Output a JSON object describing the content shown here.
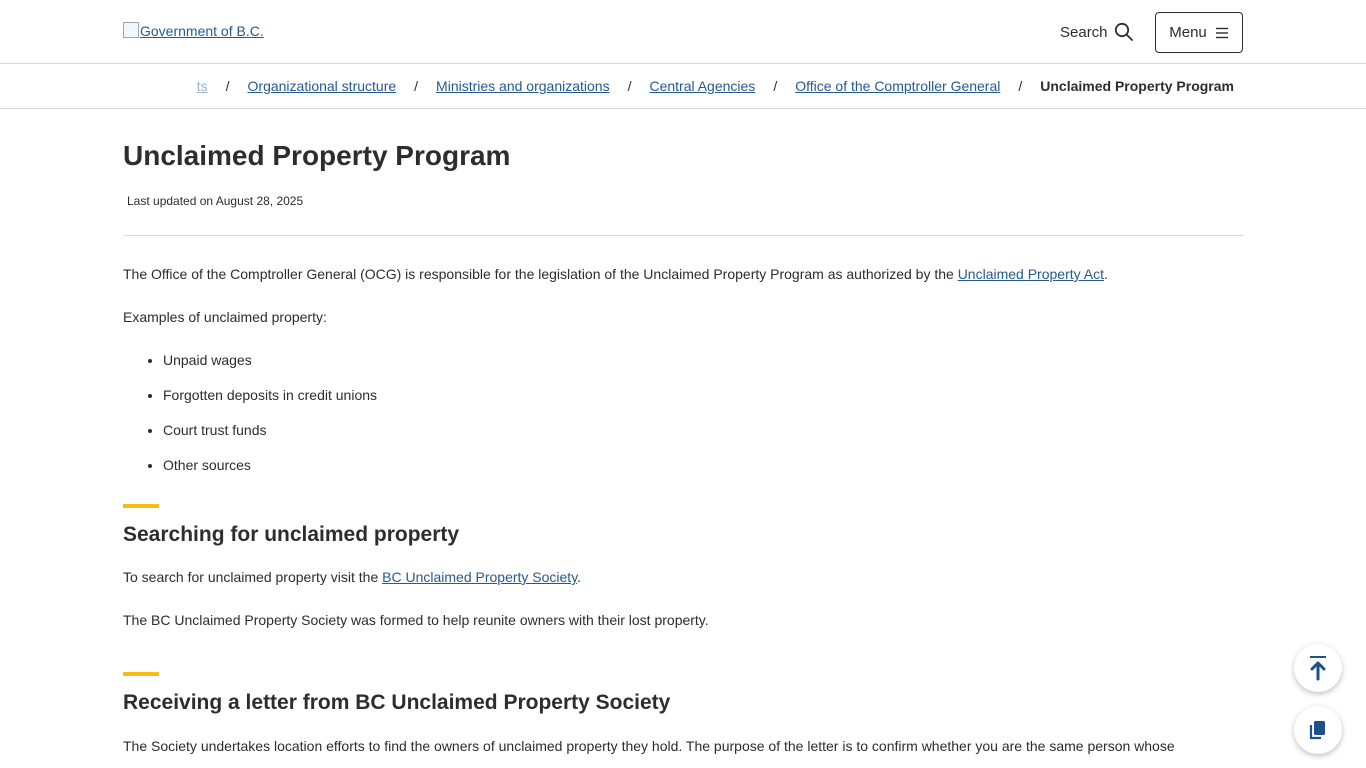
{
  "header": {
    "logo_alt": "Government of B.C.",
    "search_label": "Search",
    "menu_label": "Menu"
  },
  "breadcrumb": {
    "items": [
      {
        "label": "ts"
      },
      {
        "label": "Organizational structure"
      },
      {
        "label": "Ministries and organizations"
      },
      {
        "label": "Central Agencies"
      },
      {
        "label": "Office of the Comptroller General"
      }
    ],
    "current": "Unclaimed Property Program",
    "separator": "/"
  },
  "page": {
    "title": "Unclaimed Property Program",
    "updated": "Last updated on August 28, 2025",
    "intro_text": "The Office of the Comptroller General (OCG) is responsible for the legislation of the Unclaimed Property Program as authorized by the ",
    "intro_link": "Unclaimed Property Act",
    "intro_end": ".",
    "examples_label": "Examples of unclaimed property:",
    "examples": [
      "Unpaid wages",
      "Forgotten deposits in credit unions",
      "Court trust funds",
      "Other sources"
    ]
  },
  "section_search": {
    "heading": "Searching for unclaimed property",
    "text_before": "To search for unclaimed property visit the ",
    "link": "BC Unclaimed Property Society",
    "text_after": ".",
    "paragraph2": "The BC Unclaimed Property Society was formed to help reunite owners with their lost property."
  },
  "section_letter": {
    "heading": "Receiving a letter from BC Unclaimed Property Society",
    "paragraph1": "The Society undertakes location efforts to find the owners of unclaimed property they hold.  The purpose of the letter is to confirm whether you are the same person whose"
  },
  "fabs": {
    "top_icon": "back-to-top-icon",
    "copy_icon": "copy-icon"
  },
  "colors": {
    "link": "#255a90",
    "accent": "#fcba19",
    "text": "#2d2d2d",
    "border": "#d8d8d8"
  }
}
